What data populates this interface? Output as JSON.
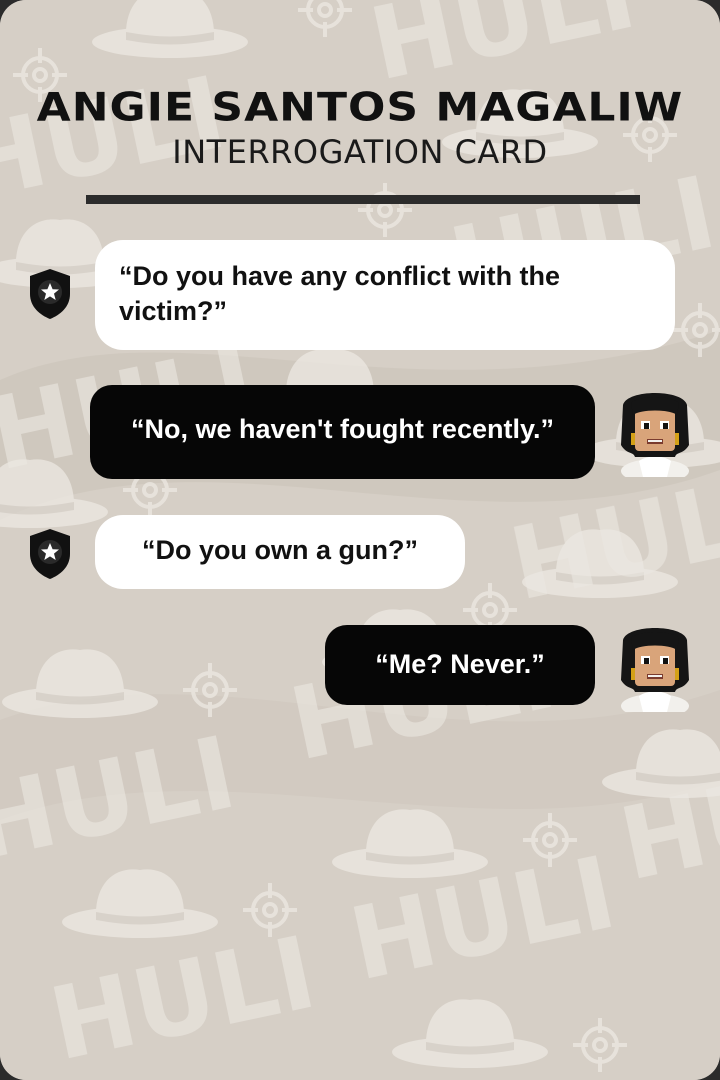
{
  "card": {
    "name": "Angie Santos Magaliw",
    "subtitle": "INTERROGATION CARD",
    "watermark": "HULI"
  },
  "dialogue": [
    {
      "speaker": "police-badge-icon",
      "text": "“Do you have any conflict with the victim?”"
    },
    {
      "speaker": "suspect-avatar",
      "text": "“No, we haven't fought recently.”"
    },
    {
      "speaker": "police-badge-icon",
      "text": "“Do you own a gun?”"
    },
    {
      "speaker": "suspect-avatar",
      "text": "“Me? Never.”"
    }
  ],
  "colors": {
    "background": "#d6cfc6",
    "title": "#111111",
    "question_bubble": "#ffffff",
    "answer_bubble": "#060606"
  }
}
